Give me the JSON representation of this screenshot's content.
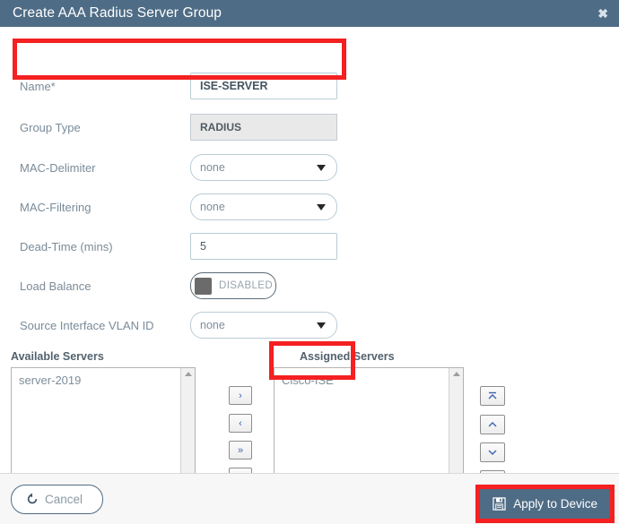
{
  "dialog": {
    "title": "Create AAA Radius Server Group",
    "close_icon": "close-icon"
  },
  "form": {
    "rows": [
      {
        "label": "Name*",
        "control": "text",
        "value": "ISE-SERVER"
      },
      {
        "label": "Group Type",
        "control": "disabled-text",
        "value": "RADIUS"
      },
      {
        "label": "MAC-Delimiter",
        "control": "select",
        "value": "none"
      },
      {
        "label": "MAC-Filtering",
        "control": "select",
        "value": "none"
      },
      {
        "label": "Dead-Time (mins)",
        "control": "text",
        "value": "5"
      },
      {
        "label": "Load Balance",
        "control": "toggle",
        "value": "DISABLED"
      },
      {
        "label": "Source Interface VLAN ID",
        "control": "select",
        "value": "none"
      }
    ]
  },
  "transfer": {
    "available_caption": "Available Servers",
    "assigned_caption": "Assigned Servers",
    "available_items": [
      "server-2019"
    ],
    "assigned_items": [
      "Cisco-ISE"
    ],
    "move_buttons": [
      {
        "glyph": "›",
        "name": "move-right-button"
      },
      {
        "glyph": "‹",
        "name": "move-left-button"
      },
      {
        "glyph": "»",
        "name": "move-all-right-button"
      },
      {
        "glyph": "«",
        "name": "move-all-left-button"
      }
    ],
    "order_buttons": [
      {
        "glyph": "move-to-top",
        "name": "move-to-top-button"
      },
      {
        "glyph": "move-up",
        "name": "move-up-button"
      },
      {
        "glyph": "move-down",
        "name": "move-down-button"
      },
      {
        "glyph": "move-to-bottom",
        "name": "move-to-bottom-button"
      }
    ]
  },
  "footer": {
    "cancel_label": "Cancel",
    "apply_label": "Apply to Device"
  },
  "colors": {
    "header": "#4e6c85",
    "accent": "#4e6c85",
    "highlight": "#f42021"
  }
}
